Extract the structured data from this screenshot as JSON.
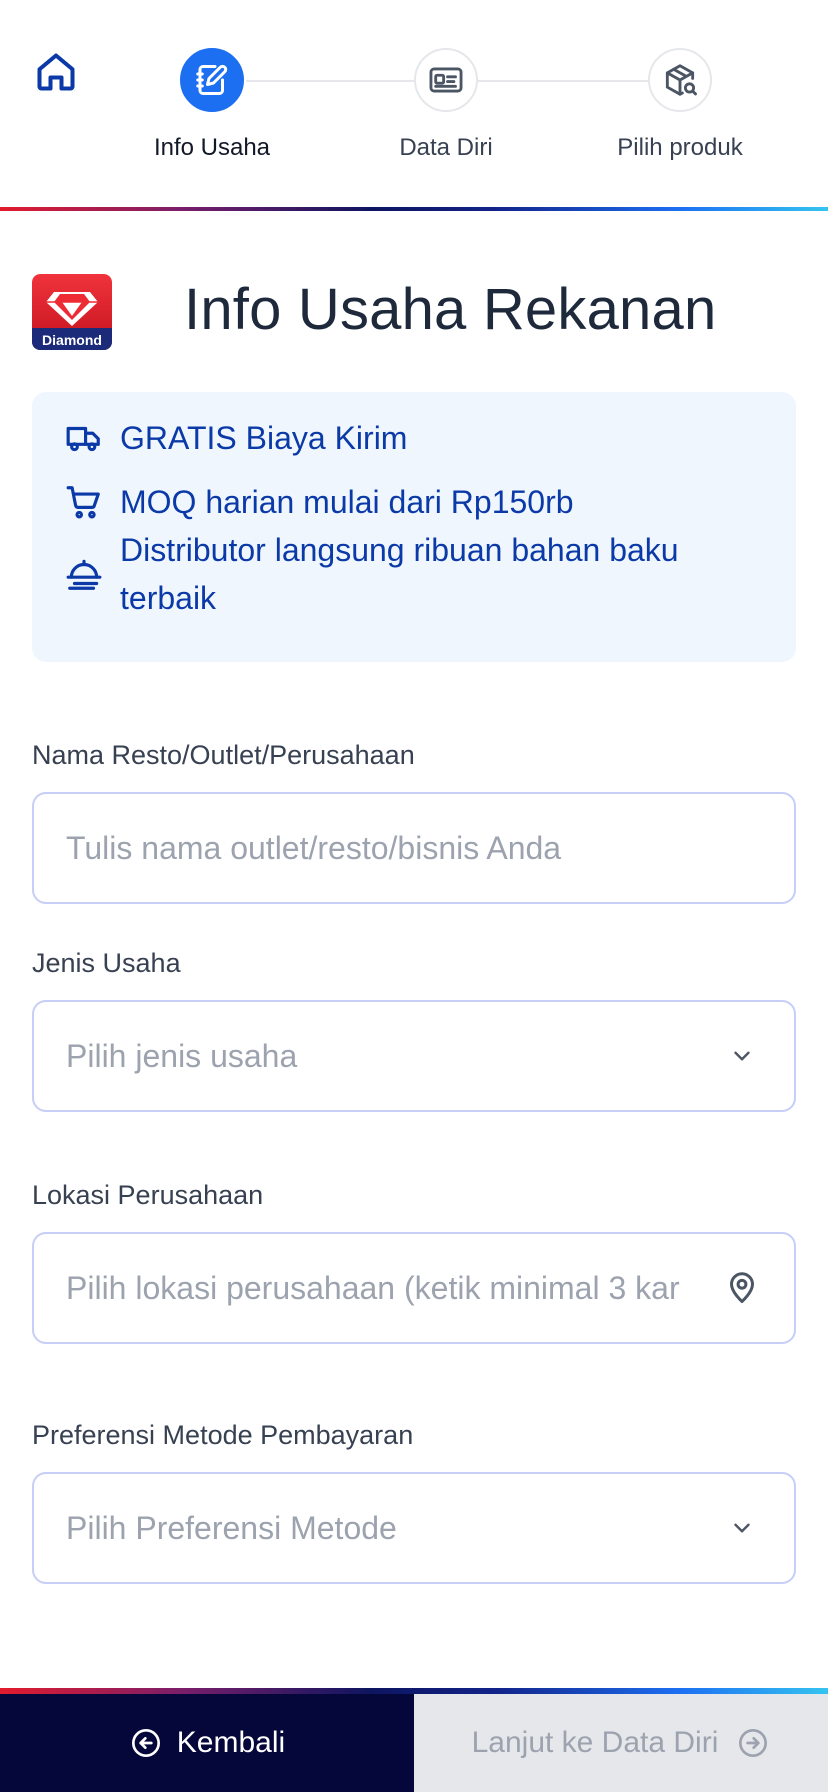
{
  "stepper": {
    "home_icon": "home-icon",
    "steps": [
      {
        "label": "Info Usaha",
        "icon": "notebook-edit-icon",
        "active": true
      },
      {
        "label": "Data Diri",
        "icon": "id-card-icon",
        "active": false
      },
      {
        "label": "Pilih produk",
        "icon": "package-search-icon",
        "active": false
      }
    ]
  },
  "brand": {
    "logo_text": "Diamond"
  },
  "title": "Info Usaha Rekanan",
  "benefits": [
    {
      "icon": "truck-icon",
      "text": "GRATIS Biaya Kirim"
    },
    {
      "icon": "cart-icon",
      "text": "MOQ harian mulai dari Rp150rb"
    },
    {
      "icon": "food-cloche-icon",
      "text_line1": "Distributor langsung ribuan bahan baku",
      "text_line2": "terbaik"
    }
  ],
  "form": {
    "business_name": {
      "label": "Nama Resto/Outlet/Perusahaan",
      "placeholder": "Tulis nama outlet/resto/bisnis Anda",
      "value": ""
    },
    "business_type": {
      "label": "Jenis Usaha",
      "placeholder": "Pilih jenis usaha"
    },
    "location": {
      "label": "Lokasi Perusahaan",
      "placeholder": "Pilih lokasi perusahaan (ketik minimal 3 kar"
    },
    "payment_pref": {
      "label": "Preferensi Metode Pembayaran",
      "placeholder": "Pilih Preferensi Metode"
    }
  },
  "footer": {
    "back_label": "Kembali",
    "next_label": "Lanjut ke Data Diri"
  },
  "colors": {
    "primary": "#1d6ff2",
    "brand_red": "#e21b2d",
    "navy": "#05063a",
    "benefit_text": "#0b3aa8",
    "benefit_bg": "#eff6fd",
    "input_border": "#c7cff8"
  }
}
